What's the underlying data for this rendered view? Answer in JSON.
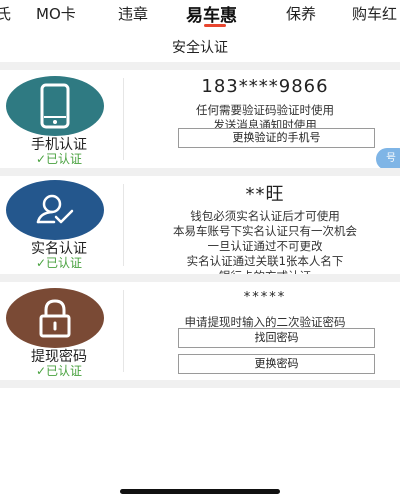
{
  "tabs": [
    {
      "label": "氏"
    },
    {
      "label": "MO卡"
    },
    {
      "label": "违章"
    },
    {
      "label": "易车惠"
    },
    {
      "label": "保养"
    },
    {
      "label": "购车红"
    }
  ],
  "active_tab_index": 3,
  "page_title": "安全认证",
  "side_badge": "号",
  "phone": {
    "name": "手机认证",
    "status": "✓已认证",
    "number": "183****9866",
    "desc_lines": [
      "任何需要验证码验证时使用",
      "发送消息通知时使用"
    ],
    "button": "更换验证的手机号",
    "icon": "smartphone-icon"
  },
  "realname": {
    "name": "实名认证",
    "status": "✓已认证",
    "holder": "**旺",
    "desc_lines": [
      "钱包必须实名认证后才可使用",
      "本易车账号下实名认证只有一次机会",
      "一旦认证通过不可更改",
      "实名认证通过关联1张本人名下",
      "银行卡的方式认证"
    ],
    "icon": "user-verified-icon"
  },
  "withdraw": {
    "name": "提现密码",
    "status": "✓已认证",
    "masked": "*****",
    "desc_lines": [
      "申请提现时输入的二次验证密码"
    ],
    "button_find": "找回密码",
    "button_change": "更换密码",
    "icon": "lock-icon"
  },
  "colors": {
    "active_underline": "#e8452f",
    "verified_green": "#4aa240",
    "phone_circle": "#2f7a82",
    "realname_circle": "#24578d",
    "withdraw_circle": "#7a4a35"
  }
}
